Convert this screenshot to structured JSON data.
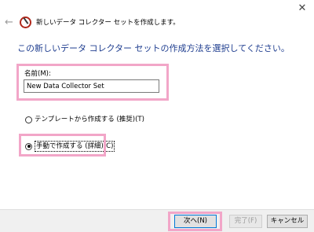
{
  "wizard": {
    "title": "新しいデータ コレクター セットを作成します。",
    "heading": "この新しいデータ コレクター セットの作成方法を選択してください。",
    "close_glyph": "✕",
    "back_glyph": "←"
  },
  "form": {
    "name_label": "名前(M):",
    "name_value": "New Data Collector Set",
    "options": [
      {
        "label": "テンプレートから作成する (推奨)(T)",
        "selected": false
      },
      {
        "label": "手動で作成する (詳細)(C)",
        "selected": true
      }
    ]
  },
  "footer": {
    "next_label": "次へ(N)",
    "finish_label": "完了(F)",
    "cancel_label": "キャンセル"
  },
  "colors": {
    "heading": "#1e3d8f",
    "highlight": "#f2a6c8",
    "focus": "#0078d7"
  }
}
